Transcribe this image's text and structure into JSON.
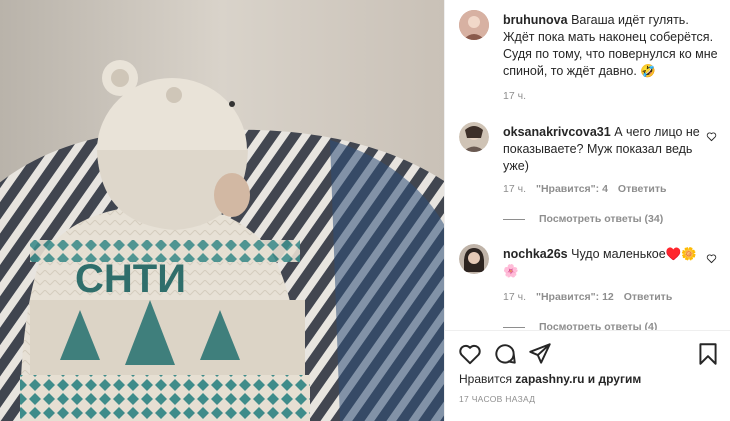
{
  "post": {
    "author": "bruhunova",
    "caption": "Вагаша идёт гулять. Ждёт пока мать наконец соберётся. Судя по тому, что повернулся ко мне спиной, то ждёт давно.",
    "caption_emoji": "🤣",
    "time": "17 ч.",
    "liked_by_prefix": "Нравится",
    "liked_by_user": "zapashny.ru",
    "liked_by_suffix": "и другим",
    "posted_ago": "17 ЧАСОВ НАЗАД"
  },
  "photo": {
    "sweater_text": "СНТИ"
  },
  "comments": [
    {
      "user": "oksanakrivcova31",
      "text": "А чего лицо не показываете? Муж показал ведь уже)",
      "time": "17 ч.",
      "likes": "\"Нравится\": 4",
      "reply": "Ответить",
      "view_replies": "Посмотреть ответы (34)"
    },
    {
      "user": "nochka26s",
      "text": "Чудо маленькое♥️🌼🌸",
      "time": "17 ч.",
      "likes": "\"Нравится\": 12",
      "reply": "Ответить",
      "view_replies": "Посмотреть ответы (4)"
    }
  ],
  "icons": {
    "like": "heart-icon",
    "comment": "comment-icon",
    "share": "share-icon",
    "save": "bookmark-icon",
    "comment_like": "small-heart-icon"
  },
  "colors": {
    "text": "#262626",
    "muted": "#8e8e8e",
    "border": "#efefef"
  }
}
